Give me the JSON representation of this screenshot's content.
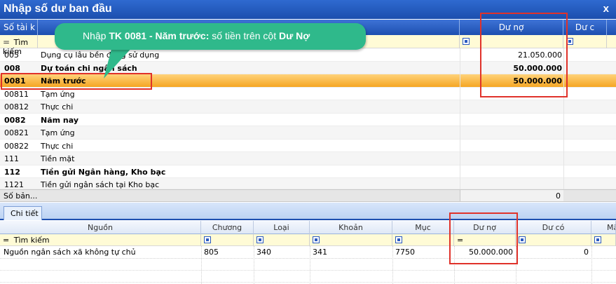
{
  "window": {
    "title": "Nhập số dư ban đầu",
    "close_label": "x"
  },
  "grid": {
    "columns": {
      "account": "Số tài k",
      "debit": "Dư nợ",
      "credit": "Dư c"
    },
    "search_label": "Tìm kiếm",
    "rows": [
      {
        "code": "005",
        "name": "Dụng cụ lâu bền đang sử dụng",
        "debit": "21.050.000",
        "style": "normal"
      },
      {
        "code": "008",
        "name": "Dự toán chi ngân sách",
        "debit": "50.000.000",
        "style": "bold"
      },
      {
        "code": "0081",
        "name": "Năm trước",
        "debit": "50.000.000",
        "style": "selected"
      },
      {
        "code": "00811",
        "name": "Tạm ứng",
        "debit": "",
        "style": "normal"
      },
      {
        "code": "00812",
        "name": "Thực chi",
        "debit": "",
        "style": "normal"
      },
      {
        "code": "0082",
        "name": "Năm nay",
        "debit": "",
        "style": "bold"
      },
      {
        "code": "00821",
        "name": "Tạm ứng",
        "debit": "",
        "style": "normal"
      },
      {
        "code": "00822",
        "name": "Thực chi",
        "debit": "",
        "style": "normal"
      },
      {
        "code": "111",
        "name": "Tiền mặt",
        "debit": "",
        "style": "normal"
      },
      {
        "code": "112",
        "name": "Tiền gửi Ngân hàng, Kho bạc",
        "debit": "",
        "style": "bold"
      },
      {
        "code": "1121",
        "name": "Tiền gửi ngân sách tại Kho bạc",
        "debit": "",
        "style": "normal"
      }
    ],
    "footer": {
      "label": "Số bản...",
      "total": "0"
    }
  },
  "callout": {
    "prefix": "Nhập ",
    "account": "TK 0081 - Năm trước:",
    "middle": " số tiền trên cột ",
    "column": "Dư Nợ"
  },
  "detail": {
    "tab_label": "Chi tiết",
    "columns": [
      "Nguồn",
      "Chương",
      "Loại",
      "Khoản",
      "Mục",
      "Dư nợ",
      "Dư có",
      "Mã"
    ],
    "search_label": "Tìm kiếm",
    "row": {
      "source": "Nguồn ngân sách xã không tự chủ",
      "chapter": "805",
      "type": "340",
      "item": "341",
      "section": "7750",
      "debit": "50.000.000",
      "credit": "0"
    }
  },
  "colors": {
    "title_blue": "#1b4fae",
    "highlight_orange": "#f5a623",
    "callout_green": "#2fb98b",
    "annotation_red": "#e0322a"
  }
}
